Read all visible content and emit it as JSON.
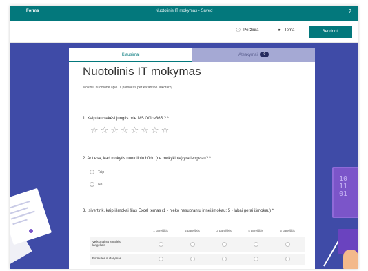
{
  "appbar": {
    "app_name": "Forms",
    "doc_title": "Nuotolinis IT mokymas - Saved",
    "help": "?"
  },
  "toolbar": {
    "preview_label": "Peržiūra",
    "theme_label": "Tema",
    "share_label": "Bendrinti",
    "more": "…"
  },
  "tabs": {
    "questions_label": "Klausimai",
    "answers_label": "Atsakymai",
    "answers_badge": "0"
  },
  "form": {
    "title": "Nuotolinis IT mokymas",
    "description": "Mokinių nuomonė apie IT pamokas per karantino laikotarpį.",
    "q1": {
      "text": "1. Kaip tau sekėsi jungtis prie MS Office365 ? *",
      "star_count": 8
    },
    "q2": {
      "text": "2. Ar tiesa, kad mokytis nuotoliniu būdu (ne mokykloje) yra lengviau? *",
      "options": [
        "Taip",
        "Ne"
      ]
    },
    "q3": {
      "text": "3. Įsivertink, kaip išmokai šias Excel temas (1 - nieko nesuprantu ir neišmokau; 5 - labai gerai išmokau) *",
      "columns": [
        "1 pareiškis",
        "2 pareiškis",
        "3 pareiškis",
        "4 pareiškis",
        "5 pareiškis"
      ],
      "rows": [
        "Veiksmai su lentelės langeliais",
        "Formulės sudarymas"
      ]
    }
  },
  "decor": {
    "monitor_text": "10\n11\n01"
  },
  "colors": {
    "brand": "#03787c",
    "canvas": "#3f4ba7",
    "answers_tab": "#a5a9d4"
  }
}
